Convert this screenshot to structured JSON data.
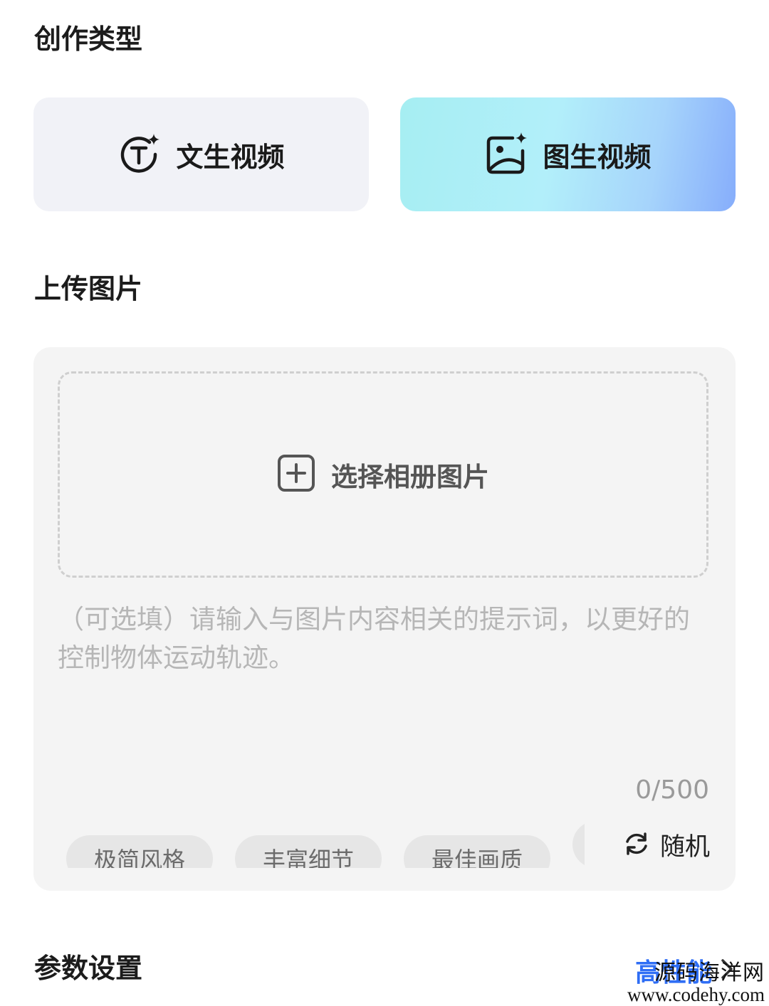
{
  "creation_type": {
    "title": "创作类型",
    "options": [
      {
        "label": "文生视频",
        "icon": "text-spark-icon",
        "selected": false
      },
      {
        "label": "图生视频",
        "icon": "image-spark-icon",
        "selected": true
      }
    ]
  },
  "upload": {
    "title": "上传图片",
    "select_label": "选择相册图片",
    "prompt_placeholder": "（可选填）请输入与图片内容相关的提示词，以更好的控制物体运动轨迹。",
    "prompt_value": "",
    "counter": "0/500",
    "chips": [
      "极简风格",
      "丰富细节",
      "最佳画质",
      ""
    ],
    "random_label": "随机"
  },
  "params": {
    "title": "参数设置",
    "mode_label": "高性能"
  },
  "watermark": {
    "line1": "源码海洋网",
    "line2": "www.codehy.com"
  },
  "colors": {
    "accent_blue": "#2f6ef5",
    "selected_gradient_start": "#a6eef2",
    "selected_gradient_end": "#86adfb",
    "unselected_card": "#f1f2f7",
    "panel_bg": "#f4f4f4",
    "chip_bg": "#e6e6e6",
    "placeholder": "#b6b6b6"
  }
}
